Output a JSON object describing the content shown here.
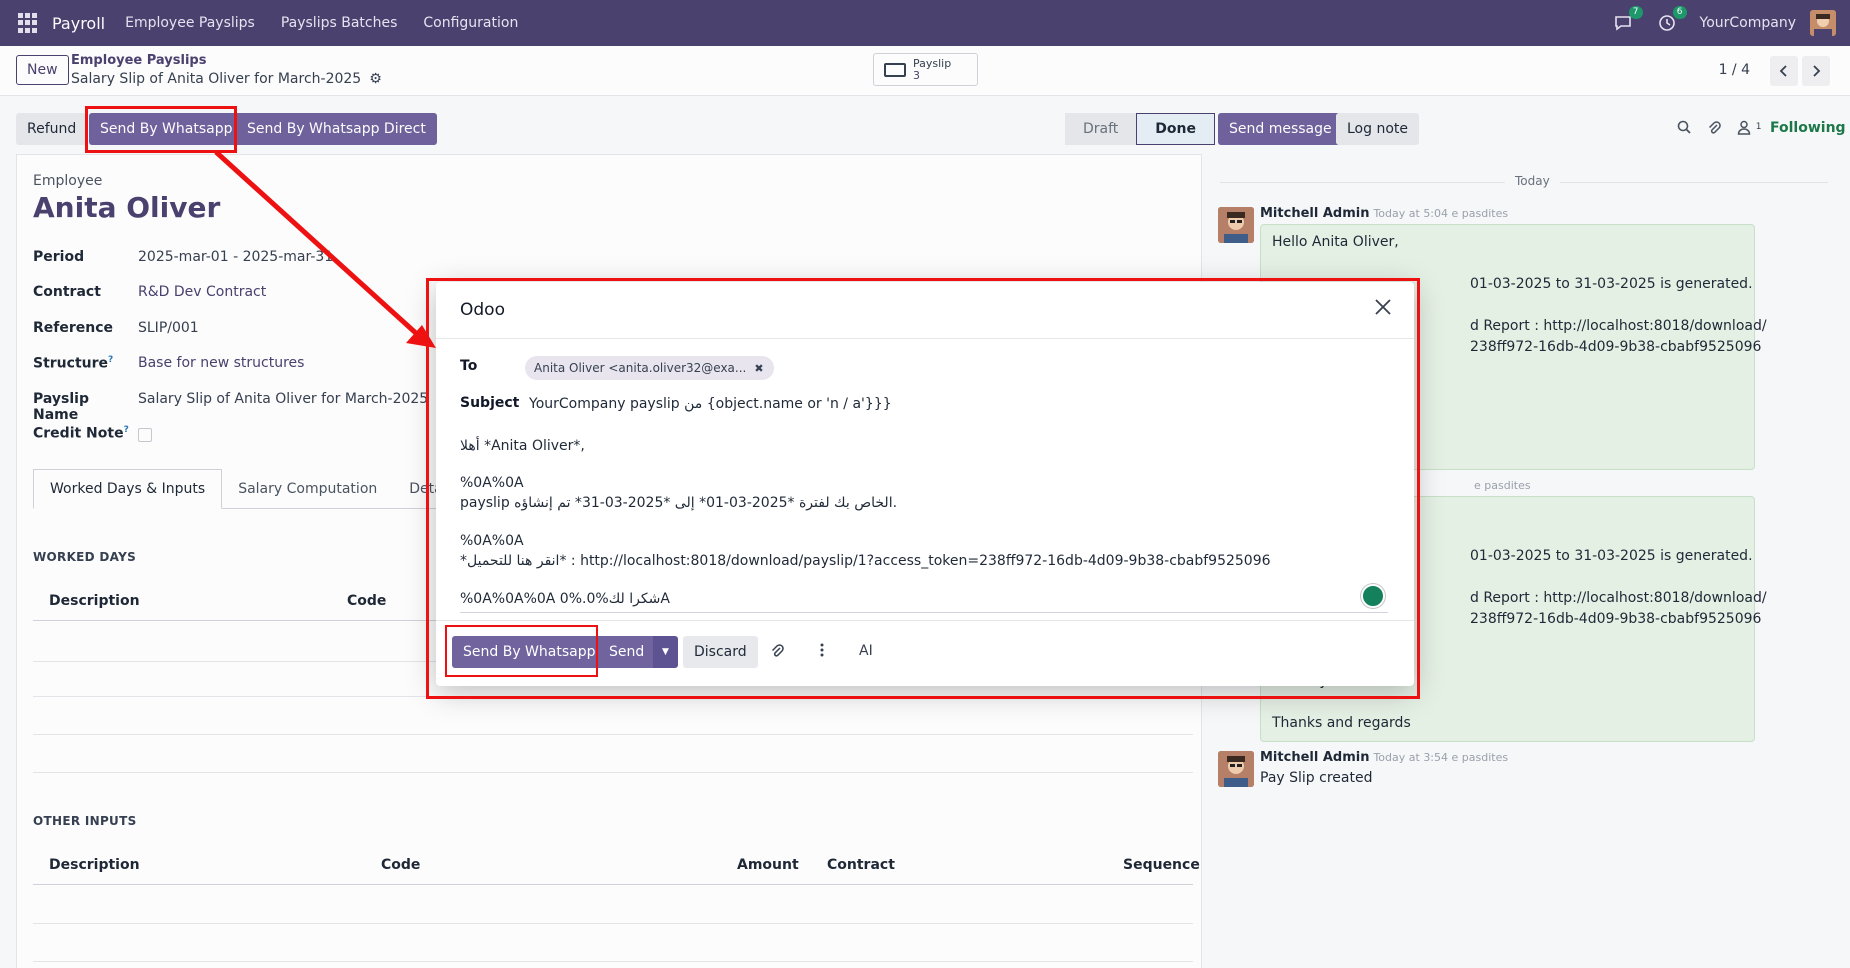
{
  "navbar": {
    "app_name": "Payroll",
    "menu": [
      "Employee Payslips",
      "Payslips Batches",
      "Configuration"
    ],
    "messages_badge": "7",
    "activities_badge": "6",
    "company": "YourCompany"
  },
  "control_panel": {
    "new_label": "New",
    "breadcrumb": "Employee Payslips",
    "record_title": "Salary Slip of Anita Oliver for March-2025",
    "smart_button": {
      "label": "Payslip",
      "count": "3"
    },
    "pager": "1 / 4"
  },
  "header_buttons": {
    "refund": "Refund",
    "send_whatsapp": "Send By Whatsapp",
    "send_whatsapp_direct": "Send By Whatsapp Direct",
    "stages": [
      "Draft",
      "Done"
    ],
    "active_stage": "Done"
  },
  "chatter": {
    "send_message": "Send message",
    "log_note": "Log note",
    "followers_count": "1",
    "following": "Following",
    "today_label": "Today",
    "messages": [
      {
        "author": "Mitchell Admin",
        "time": "Today at 5:04 e pasdites",
        "lines": [
          "Hello Anita Oliver,",
          "01-03-2025 to 31-03-2025 is generated.",
          "d Report : http://localhost:8018/download/",
          "238ff972-16db-4d09-9b38-cbabf9525096"
        ]
      },
      {
        "author": "",
        "time": "e pasdites",
        "lines": [
          "01-03-2025 to 31-03-2025 is generated.",
          "d Report : http://localhost:8018/download/",
          "238ff972-16db-4d09-9b38-cbabf9525096",
          "Thank you!",
          "Thanks and regards"
        ]
      },
      {
        "author": "Mitchell Admin",
        "time": "Today at 3:54 e pasdites",
        "lines": [
          "Pay Slip created"
        ]
      }
    ]
  },
  "form": {
    "employee_label": "Employee",
    "employee_name": "Anita Oliver",
    "fields": [
      {
        "label": "Period",
        "value": "2025-mar-01 - 2025-mar-31",
        "link": false,
        "help": false
      },
      {
        "label": "Contract",
        "value": "R&D Dev Contract",
        "link": true,
        "help": false
      },
      {
        "label": "Reference",
        "value": "SLIP/001",
        "link": false,
        "help": false
      },
      {
        "label": "Structure",
        "value": "Base for new structures",
        "link": true,
        "help": true
      },
      {
        "label": "Payslip Name",
        "value": "Salary Slip of Anita Oliver for March-2025",
        "link": false,
        "help": false
      },
      {
        "label": "Credit Note",
        "value": "",
        "link": false,
        "help": true
      }
    ],
    "help_mark": "?",
    "tabs": [
      "Worked Days & Inputs",
      "Salary Computation",
      "Details B"
    ],
    "worked_days": {
      "title": "WORKED DAYS",
      "columns": [
        "Description",
        "Code"
      ]
    },
    "other_inputs": {
      "title": "OTHER INPUTS",
      "columns": [
        "Description",
        "Code",
        "Amount",
        "Contract",
        "Sequence"
      ]
    }
  },
  "modal": {
    "title": "Odoo",
    "to_label": "To",
    "recipient": "Anita Oliver <anita.oliver32@exa...",
    "subject_label": "Subject",
    "subject": "YourCompany payslip من {object.name or 'n / a'}}}",
    "body_lines": [
      "أهلا *Anita Oliver*,",
      "%0A%0A",
      "payslip الخاص بك لفترة *2025-03-01* إلى *2025-03-31* تم إنشاؤه.",
      "%0A%0A",
      "*انقر هنا للتحميل* : http://localhost:8018/download/payslip/1?access_token=238ff972-16db-4d09-9b38-cbabf9525096",
      "%0A%0A%0A 0%.شكرا لك%0A"
    ],
    "buttons": {
      "send_whatsapp": "Send By Whatsapp",
      "send": "Send",
      "discard": "Discard",
      "ai": "AI"
    }
  },
  "colors": {
    "navbar": "#4b4270",
    "primary": "#71639e",
    "highlight": "#ee1111"
  }
}
